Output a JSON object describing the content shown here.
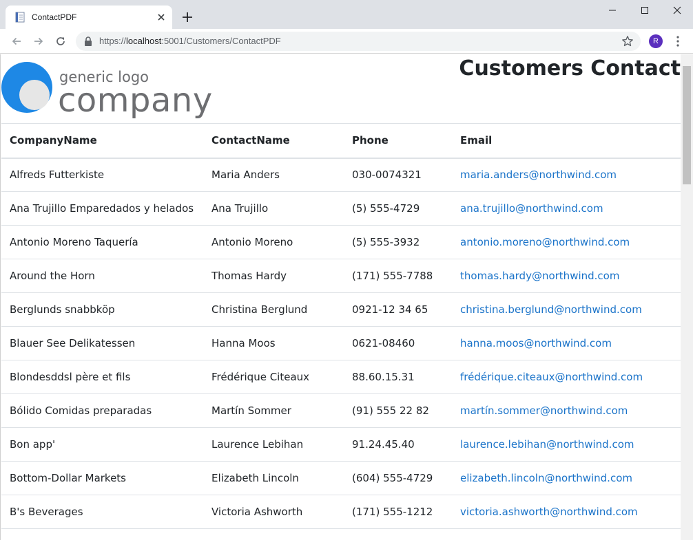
{
  "browser": {
    "tab_title": "ContactPDF",
    "url_prefix": "https://",
    "url_host": "localhost",
    "url_rest": ":5001/Customers/ContactPDF",
    "avatar_letter": "R"
  },
  "logo": {
    "tagline": "generic logo",
    "name": "company",
    "colors": {
      "ring": "#1e88e5",
      "inner": "#e6e6e6",
      "text": "#6d6e71"
    }
  },
  "page": {
    "title": "Customers Contact"
  },
  "table": {
    "headers": [
      "CompanyName",
      "ContactName",
      "Phone",
      "Email"
    ],
    "rows": [
      [
        "Alfreds Futterkiste",
        "Maria Anders",
        "030-0074321",
        "maria.anders@northwind.com"
      ],
      [
        "Ana Trujillo Emparedados y helados",
        "Ana Trujillo",
        "(5) 555-4729",
        "ana.trujillo@northwind.com"
      ],
      [
        "Antonio Moreno Taquería",
        "Antonio Moreno",
        "(5) 555-3932",
        "antonio.moreno@northwind.com"
      ],
      [
        "Around the Horn",
        "Thomas Hardy",
        "(171) 555-7788",
        "thomas.hardy@northwind.com"
      ],
      [
        "Berglunds snabbköp",
        "Christina Berglund",
        "0921-12 34 65",
        "christina.berglund@northwind.com"
      ],
      [
        "Blauer See Delikatessen",
        "Hanna Moos",
        "0621-08460",
        "hanna.moos@northwind.com"
      ],
      [
        "Blondesddsl père et fils",
        "Frédérique Citeaux",
        "88.60.15.31",
        "frédérique.citeaux@northwind.com"
      ],
      [
        "Bólido Comidas preparadas",
        "Martín Sommer",
        "(91) 555 22 82",
        "martín.sommer@northwind.com"
      ],
      [
        "Bon app'",
        "Laurence Lebihan",
        "91.24.45.40",
        "laurence.lebihan@northwind.com"
      ],
      [
        "Bottom-Dollar Markets",
        "Elizabeth Lincoln",
        "(604) 555-4729",
        "elizabeth.lincoln@northwind.com"
      ],
      [
        "B's Beverages",
        "Victoria Ashworth",
        "(171) 555-1212",
        "victoria.ashworth@northwind.com"
      ],
      [
        "",
        "",
        "",
        ""
      ]
    ]
  },
  "colors": {
    "link": "#1a73c9",
    "text": "#212529",
    "chrome": "#dee1e6"
  }
}
